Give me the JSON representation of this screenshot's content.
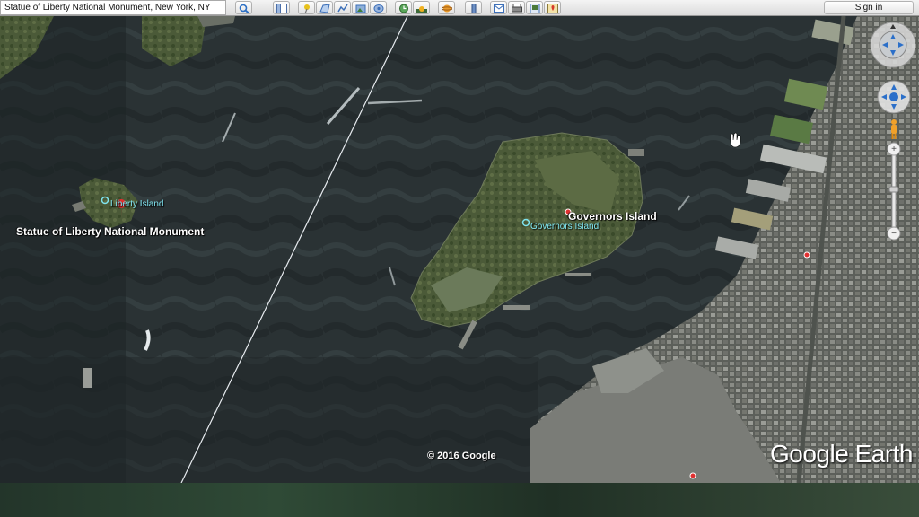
{
  "toolbar": {
    "search_value": "Statue of Liberty National Monument, New York, NY",
    "signin_label": "Sign in",
    "buttons": [
      {
        "name": "search-button",
        "icon": "magnifier-icon"
      },
      {
        "name": "sidebar-toggle-button",
        "icon": "sidebar-icon"
      },
      {
        "name": "add-placemark-button",
        "icon": "pushpin-icon"
      },
      {
        "name": "add-polygon-button",
        "icon": "polygon-icon"
      },
      {
        "name": "add-path-button",
        "icon": "path-icon"
      },
      {
        "name": "add-overlay-button",
        "icon": "image-overlay-icon"
      },
      {
        "name": "record-tour-button",
        "icon": "tour-icon"
      },
      {
        "name": "historical-imagery-button",
        "icon": "clock-icon"
      },
      {
        "name": "sunlight-button",
        "icon": "sun-icon"
      },
      {
        "name": "switch-to-sky-button",
        "icon": "planet-icon"
      },
      {
        "name": "ruler-button",
        "icon": "ruler-icon"
      },
      {
        "name": "email-button",
        "icon": "envelope-icon"
      },
      {
        "name": "print-button",
        "icon": "printer-icon"
      },
      {
        "name": "save-image-button",
        "icon": "image-save-icon"
      },
      {
        "name": "view-in-maps-button",
        "icon": "maps-icon"
      }
    ]
  },
  "map": {
    "labels": {
      "liberty_island": "Liberty Island",
      "statue_of_liberty": "Statue of Liberty National Monument",
      "governors_island_main": "Governors Island",
      "governors_island_sub": "Governors Island"
    },
    "copyright": "© 2016 Google",
    "brand": "Google Earth",
    "colors": {
      "water": "#2b3335",
      "land": "#4a5a3a",
      "marker_red": "#e03030",
      "marker_cyan": "#7fe4f0"
    }
  }
}
